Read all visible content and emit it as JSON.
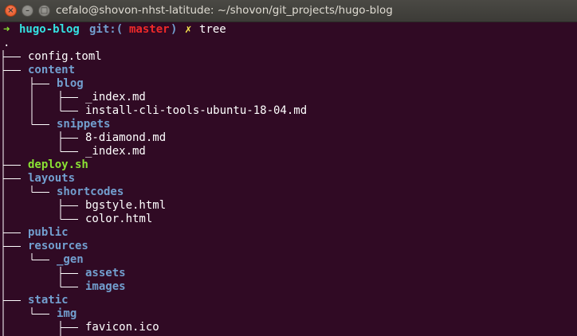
{
  "window": {
    "title": "cefalo@shovon-nhst-latitude: ~/shovon/git_projects/hugo-blog",
    "close_glyph": "×",
    "min_glyph": "–",
    "max_glyph": "□"
  },
  "prompt": {
    "arrow": "➜",
    "dir": "hugo-blog",
    "git_label": "git:(",
    "branch": "master",
    "git_close": ")",
    "dirty_mark": "✗",
    "command": "tree"
  },
  "tree_root": ".",
  "colors": {
    "background": "#300a24",
    "arrow": "#8ae234",
    "prompt_dir": "#34e2e2",
    "git_label": "#729fcf",
    "branch": "#ef2929",
    "dirty_mark": "#fce94f",
    "directory": "#729fcf",
    "executable": "#8ae234",
    "file": "#ffffff",
    "tree_lines": "#ffffff"
  },
  "tree": [
    {
      "name": "config.toml",
      "type": "file"
    },
    {
      "name": "content",
      "type": "dir"
    },
    {
      "name": "blog",
      "type": "dir"
    },
    {
      "name": "_index.md",
      "type": "file"
    },
    {
      "name": "install-cli-tools-ubuntu-18-04.md",
      "type": "file"
    },
    {
      "name": "snippets",
      "type": "dir"
    },
    {
      "name": "8-diamond.md",
      "type": "file"
    },
    {
      "name": "_index.md",
      "type": "file"
    },
    {
      "name": "deploy.sh",
      "type": "exec"
    },
    {
      "name": "layouts",
      "type": "dir"
    },
    {
      "name": "shortcodes",
      "type": "dir"
    },
    {
      "name": "bgstyle.html",
      "type": "file"
    },
    {
      "name": "color.html",
      "type": "file"
    },
    {
      "name": "public",
      "type": "dir"
    },
    {
      "name": "resources",
      "type": "dir"
    },
    {
      "name": "_gen",
      "type": "dir"
    },
    {
      "name": "assets",
      "type": "dir"
    },
    {
      "name": "images",
      "type": "dir"
    },
    {
      "name": "static",
      "type": "dir"
    },
    {
      "name": "img",
      "type": "dir"
    },
    {
      "name": "favicon.ico",
      "type": "file"
    }
  ]
}
